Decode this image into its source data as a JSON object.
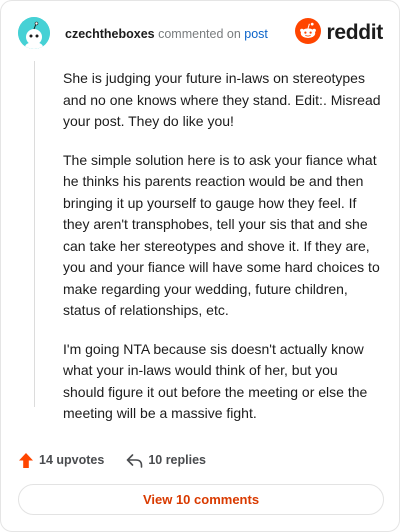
{
  "header": {
    "username": "czechtheboxes",
    "action_text": "commented on",
    "post_link": "post",
    "brand": "reddit"
  },
  "comment": {
    "paragraphs": [
      "She is judging your future in-laws on stereotypes and no one knows where they stand. Edit:. Misread your post. They do like you!",
      "The simple solution here is to ask your fiance what he thinks his parents reaction would be and then bringing it up yourself to gauge how they feel. If they aren't transphobes, tell your sis that and she can take her stereotypes and shove it. If they are, you and your fiance will have some hard choices to make regarding your wedding, future children, status of relationships, etc.",
      "I'm going NTA because sis doesn't actually know what your in-laws would think of her, but you should figure it out before the meeting or else the meeting will be a massive fight."
    ]
  },
  "actions": {
    "upvotes": "14 upvotes",
    "replies": "10 replies"
  },
  "view_comments_label": "View 10 comments",
  "colors": {
    "brand_orange": "#ff4500",
    "avatar_bg": "#46d1d5",
    "link_blue": "#0a63c9",
    "button_text": "#d93a00"
  },
  "icons": {
    "avatar": "snoo-avatar-icon",
    "logo": "reddit-snoo-icon",
    "upvote": "upvote-arrow-icon",
    "reply": "reply-arrow-icon"
  }
}
